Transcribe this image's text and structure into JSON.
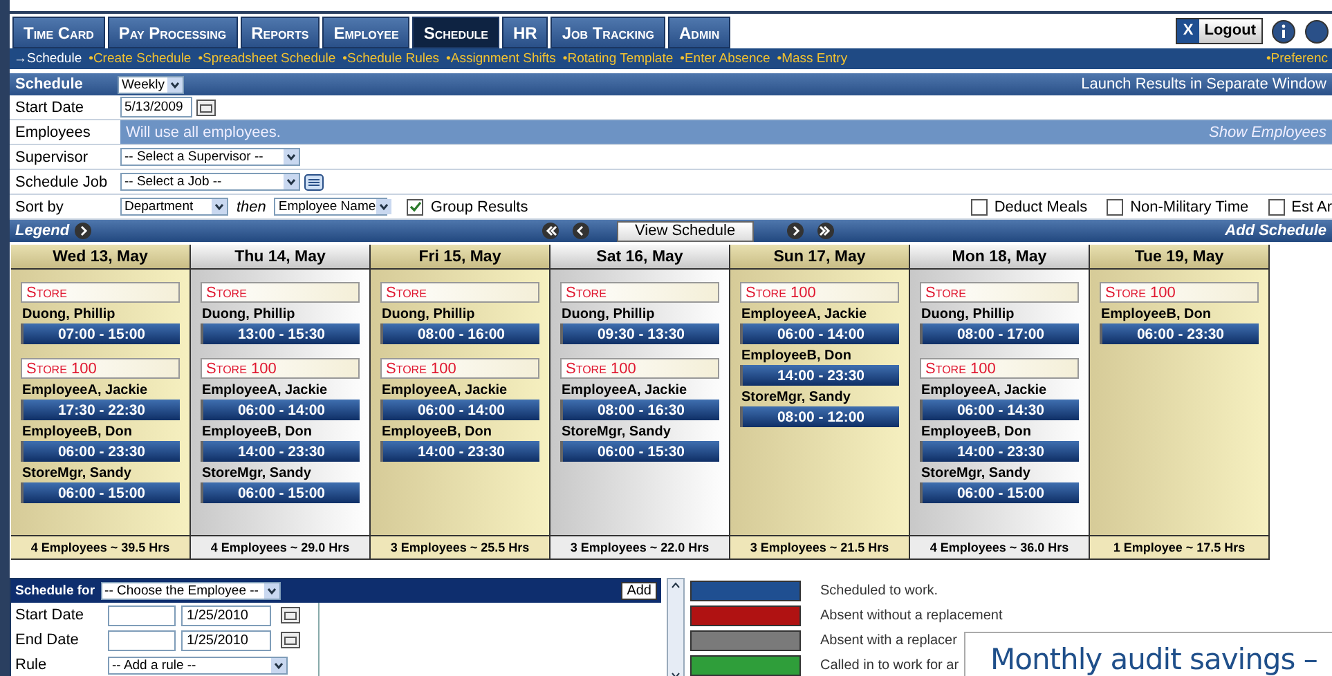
{
  "tabs": [
    {
      "label": "Time Card",
      "selected": false
    },
    {
      "label": "Pay Processing",
      "selected": false
    },
    {
      "label": "Reports",
      "selected": false
    },
    {
      "label": "Employee",
      "selected": false
    },
    {
      "label": "Schedule",
      "selected": true
    },
    {
      "label": "HR",
      "selected": false
    },
    {
      "label": "Job Tracking",
      "selected": false
    },
    {
      "label": "Admin",
      "selected": false
    }
  ],
  "logout": {
    "icon": "X",
    "label": "Logout"
  },
  "subnav": [
    {
      "label": "→Schedule",
      "selected": true
    },
    {
      "label": "•Create Schedule",
      "selected": false
    },
    {
      "label": "•Spreadsheet Schedule",
      "selected": false
    },
    {
      "label": "•Schedule Rules",
      "selected": false
    },
    {
      "label": "•Assignment Shifts",
      "selected": false
    },
    {
      "label": "•Rotating Template",
      "selected": false
    },
    {
      "label": "•Enter Absence",
      "selected": false
    },
    {
      "label": "•Mass Entry",
      "selected": false
    }
  ],
  "subnav_right": "•Preferenc",
  "form": {
    "title": "Schedule",
    "view": "Weekly",
    "launch_link": "Launch Results in Separate Window",
    "start_date_label": "Start Date",
    "start_date": "5/13/2009",
    "employees_label": "Employees",
    "employees_note": "Will use all employees.",
    "show_employees": "Show Employees",
    "supervisor_label": "Supervisor",
    "supervisor": "-- Select a Supervisor --",
    "job_label": "Schedule Job",
    "job": "-- Select a Job --",
    "sort_label": "Sort by",
    "sort_1": "Department",
    "then": "then",
    "sort_2": "Employee Name",
    "options": [
      {
        "label": "Group Results",
        "checked": true
      },
      {
        "label": "Deduct Meals",
        "checked": false
      },
      {
        "label": "Non-Military Time",
        "checked": false
      },
      {
        "label": "Est Ar",
        "checked": false
      }
    ]
  },
  "legend_bar": {
    "legend": "Legend",
    "view_button": "View Schedule",
    "add_schedule": "Add Schedule"
  },
  "days": [
    {
      "header": "Wed 13, May",
      "shaded": true,
      "groups": [
        {
          "store": "Store",
          "shifts": [
            {
              "name": "Duong, Phillip",
              "time": "07:00 - 15:00"
            }
          ]
        },
        {
          "store": "Store 100",
          "shifts": [
            {
              "name": "EmployeeA, Jackie",
              "time": "17:30 - 22:30"
            },
            {
              "name": "EmployeeB, Don",
              "time": "06:00 - 23:30"
            },
            {
              "name": "StoreMgr, Sandy",
              "time": "06:00 - 15:00"
            }
          ]
        }
      ],
      "footer": "4 Employees ~ 39.5 Hrs"
    },
    {
      "header": "Thu 14, May",
      "shaded": false,
      "groups": [
        {
          "store": "Store",
          "shifts": [
            {
              "name": "Duong, Phillip",
              "time": "13:00 - 15:30"
            }
          ]
        },
        {
          "store": "Store 100",
          "shifts": [
            {
              "name": "EmployeeA, Jackie",
              "time": "06:00 - 14:00"
            },
            {
              "name": "EmployeeB, Don",
              "time": "14:00 - 23:30"
            },
            {
              "name": "StoreMgr, Sandy",
              "time": "06:00 - 15:00"
            }
          ]
        }
      ],
      "footer": "4 Employees ~ 29.0 Hrs"
    },
    {
      "header": "Fri 15, May",
      "shaded": true,
      "groups": [
        {
          "store": "Store",
          "shifts": [
            {
              "name": "Duong, Phillip",
              "time": "08:00 - 16:00"
            }
          ]
        },
        {
          "store": "Store 100",
          "shifts": [
            {
              "name": "EmployeeA, Jackie",
              "time": "06:00 - 14:00"
            },
            {
              "name": "EmployeeB, Don",
              "time": "14:00 - 23:30"
            }
          ]
        }
      ],
      "footer": "3 Employees ~ 25.5 Hrs"
    },
    {
      "header": "Sat 16, May",
      "shaded": false,
      "groups": [
        {
          "store": "Store",
          "shifts": [
            {
              "name": "Duong, Phillip",
              "time": "09:30 - 13:30"
            }
          ]
        },
        {
          "store": "Store 100",
          "shifts": [
            {
              "name": "EmployeeA, Jackie",
              "time": "08:00 - 16:30"
            },
            {
              "name": "StoreMgr, Sandy",
              "time": "06:00 - 15:30"
            }
          ]
        }
      ],
      "footer": "3 Employees ~ 22.0 Hrs"
    },
    {
      "header": "Sun 17, May",
      "shaded": true,
      "groups": [
        {
          "store": "Store 100",
          "shifts": [
            {
              "name": "EmployeeA, Jackie",
              "time": "06:00 - 14:00"
            },
            {
              "name": "EmployeeB, Don",
              "time": "14:00 - 23:30"
            },
            {
              "name": "StoreMgr, Sandy",
              "time": "08:00 - 12:00"
            }
          ]
        }
      ],
      "footer": "3 Employees ~ 21.5 Hrs"
    },
    {
      "header": "Mon 18, May",
      "shaded": false,
      "groups": [
        {
          "store": "Store",
          "shifts": [
            {
              "name": "Duong, Phillip",
              "time": "08:00 - 17:00"
            }
          ]
        },
        {
          "store": "Store 100",
          "shifts": [
            {
              "name": "EmployeeA, Jackie",
              "time": "06:00 - 14:30"
            },
            {
              "name": "EmployeeB, Don",
              "time": "14:00 - 23:30"
            },
            {
              "name": "StoreMgr, Sandy",
              "time": "06:00 - 15:00"
            }
          ]
        }
      ],
      "footer": "4 Employees ~ 36.0 Hrs"
    },
    {
      "header": "Tue 19, May",
      "shaded": true,
      "groups": [
        {
          "store": "Store 100",
          "shifts": [
            {
              "name": "EmployeeB, Don",
              "time": "06:00 - 23:30"
            }
          ]
        }
      ],
      "footer": "1 Employee ~ 17.5 Hrs"
    }
  ],
  "entry": {
    "title": "Schedule for",
    "employee": "-- Choose the Employee --",
    "add": "Add",
    "rows": [
      {
        "label": "Start Date",
        "date": "1/25/2010"
      },
      {
        "label": "End Date",
        "date": "1/25/2010"
      }
    ],
    "rule_label": "Rule",
    "rule": "-- Add a rule --"
  },
  "color_legend": [
    {
      "label": "Scheduled to work.",
      "color": "#1f4f91"
    },
    {
      "label": "Absent without a replacement",
      "color": "#b01212"
    },
    {
      "label": "Absent with a replacer",
      "color": "#7a7a7a"
    },
    {
      "label": "Called in to work for ar",
      "color": "#2f9e3a"
    }
  ],
  "overlay": {
    "text": "Monthly audit savings –"
  }
}
